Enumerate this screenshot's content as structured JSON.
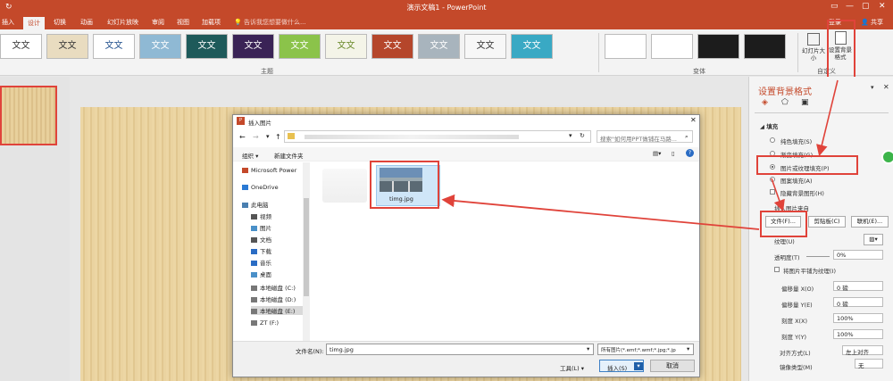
{
  "titlebar": {
    "title": "演示文稿1 - PowerPoint",
    "quick_access": "↻"
  },
  "tabs": [
    "插入",
    "设计",
    "切换",
    "动画",
    "幻灯片放映",
    "审阅",
    "视图",
    "加载项"
  ],
  "active_tab": "设计",
  "tellme": "告诉我您想要做什么...",
  "login": "登录",
  "share": "共享",
  "themes": [
    {
      "label": "文文",
      "bg": "#ffffff",
      "fg": "#333333"
    },
    {
      "label": "文文",
      "bg": "#e9dcc0",
      "fg": "#333333"
    },
    {
      "label": "文文",
      "bg": "#ffffff",
      "fg": "#1f4e8c"
    },
    {
      "label": "文文",
      "bg": "#8fb9d4",
      "fg": "#ffffff"
    },
    {
      "label": "文文",
      "bg": "#1e5a5a",
      "fg": "#ffffff"
    },
    {
      "label": "文文",
      "bg": "#3a2356",
      "fg": "#ffffff"
    },
    {
      "label": "文文",
      "bg": "#8bc34a",
      "fg": "#ffffff"
    },
    {
      "label": "文文",
      "bg": "#f4f4e8",
      "fg": "#6a8a2a"
    },
    {
      "label": "文文",
      "bg": "#b5462b",
      "fg": "#ffffff"
    },
    {
      "label": "文文",
      "bg": "#a8b4bd",
      "fg": "#ffffff"
    },
    {
      "label": "文文",
      "bg": "#f7f7f7",
      "fg": "#333333"
    },
    {
      "label": "文文",
      "bg": "#39a9c4",
      "fg": "#ffffff"
    }
  ],
  "variants": [
    "#ffffff",
    "#ffffff",
    "#1c1c1c",
    "#1c1c1c"
  ],
  "groups": {
    "themes": "主题",
    "variants": "变体",
    "customize": "自定义"
  },
  "ribbon_buttons": {
    "slide_size": "幻灯片大小",
    "format_bg": "设置背景格式"
  },
  "format_pane": {
    "title": "设置背景格式",
    "fill_heading": "填充",
    "options": [
      "纯色填充(S)",
      "渐变填充(G)",
      "图片或纹理填充(P)",
      "图案填充(A)"
    ],
    "selected_option": "图片或纹理填充(P)",
    "hide_bg": "隐藏背景图形(H)",
    "insert_from": "插入图片来自",
    "btn_file": "文件(F)...",
    "btn_clipboard": "剪贴板(C)",
    "btn_online": "联机(E)...",
    "texture": "纹理(U)",
    "transparency_label": "透明度(T)",
    "transparency_value": "0%",
    "tile_label": "将图片平铺为纹理(I)",
    "offset_x_label": "偏移量 X(O)",
    "offset_x_value": "0 磅",
    "offset_y_label": "偏移量 Y(E)",
    "offset_y_value": "0 磅",
    "scale_x_label": "刻度 X(X)",
    "scale_x_value": "100%",
    "scale_y_label": "刻度 Y(Y)",
    "scale_y_value": "100%",
    "align_label": "对齐方式(L)",
    "align_value": "左上对齐",
    "mirror_label": "镜像类型(M)",
    "mirror_value": "无"
  },
  "dialog": {
    "title": "插入图片",
    "search_placeholder": "搜索\"如何用PPT做铺在马路...",
    "organize": "组织 ▾",
    "new_folder": "新建文件夹",
    "nav": [
      "Microsoft Power",
      "OneDrive",
      "此电脑",
      "视频",
      "图片",
      "文档",
      "下载",
      "音乐",
      "桌面",
      "本地磁盘 (C:)",
      "本地磁盘 (D:)",
      "本地磁盘 (E:)",
      "ZT (F:)"
    ],
    "file_name": "timg.jpg",
    "filename_label": "文件名(N):",
    "filename_value": "timg.jpg",
    "filetype_value": "所有图片(*.emf;*.wmf;*.jpg;*.jp",
    "tools": "工具(L)",
    "insert": "插入(S)",
    "cancel": "取消"
  }
}
